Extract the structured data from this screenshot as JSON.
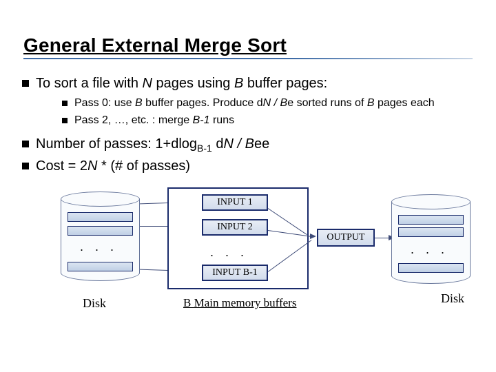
{
  "title": "General External Merge Sort",
  "bullets": {
    "b1_pre": "To sort a file with ",
    "b1_n": "N",
    "b1_mid": " pages using ",
    "b1_b": "B",
    "b1_post": " buffer pages:",
    "s1_pre": "Pass 0: use ",
    "s1_b": "B",
    "s1_mid": " buffer pages. Produce d",
    "s1_n": "N / B",
    "s1_post": "e sorted runs of ",
    "s1_b2": "B",
    "s1_end": " pages each",
    "s2_pre": "Pass 2, …, etc. : merge ",
    "s2_b": "B-1",
    "s2_post": " runs",
    "b2_pre": "Number of passes:  1+dlog",
    "b2_sub": "B-1",
    "b2_mid": " d",
    "b2_n": "N / B",
    "b2_post": "ee",
    "b3_pre": "Cost = 2",
    "b3_n": "N",
    "b3_post": " * (# of passes)"
  },
  "diagram": {
    "input1": "INPUT 1",
    "input2": "INPUT 2",
    "inputB": "INPUT B-1",
    "output": "OUTPUT",
    "dots": ".  .  .",
    "mem_label": "B Main memory buffers",
    "disk_label": "Disk"
  }
}
